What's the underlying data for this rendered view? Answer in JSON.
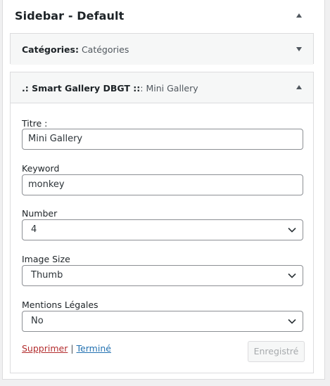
{
  "sidebar": {
    "title": "Sidebar - Default"
  },
  "widgets": {
    "categories": {
      "name": "Catégories:",
      "in_title": "Catégories"
    },
    "gallery": {
      "name": ".: Smart Gallery DBGT ::",
      "in_title": ": Mini Gallery",
      "fields": {
        "title_label": "Titre :",
        "title_value": "Mini Gallery",
        "keyword_label": "Keyword",
        "keyword_value": "monkey",
        "number_label": "Number",
        "number_value": "4",
        "image_size_label": "Image Size",
        "image_size_value": "Thumb",
        "mentions_label": "Mentions Légales",
        "mentions_value": "No"
      },
      "actions": {
        "delete_label": "Supprimer",
        "separator": "|",
        "done_label": "Terminé",
        "save_label": "Enregistré"
      }
    }
  }
}
